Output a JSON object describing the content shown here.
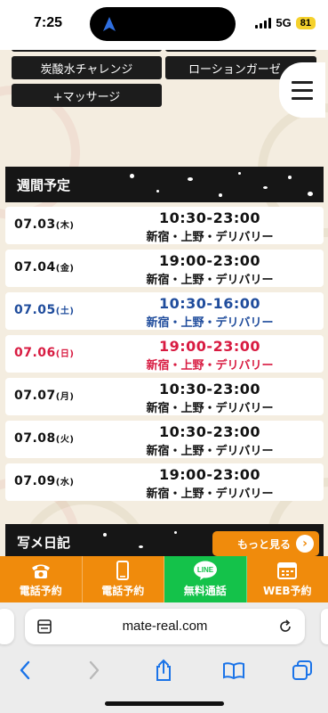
{
  "status": {
    "time": "7:25",
    "network": "5G",
    "battery": "81"
  },
  "tags": [
    "炭酸水チャレンジ",
    "ローションガーゼ",
    "+マッサージ"
  ],
  "weekly": {
    "title": "週間予定",
    "rows": [
      {
        "date": "07.03",
        "day": "(木)",
        "time": "10:30-23:00",
        "area": "新宿・上野・デリバリー",
        "color": "#111111"
      },
      {
        "date": "07.04",
        "day": "(金)",
        "time": "19:00-23:00",
        "area": "新宿・上野・デリバリー",
        "color": "#111111"
      },
      {
        "date": "07.05",
        "day": "(土)",
        "time": "10:30-16:00",
        "area": "新宿・上野・デリバリー",
        "color": "#1f4c9c"
      },
      {
        "date": "07.06",
        "day": "(日)",
        "time": "19:00-23:00",
        "area": "新宿・上野・デリバリー",
        "color": "#d81b41"
      },
      {
        "date": "07.07",
        "day": "(月)",
        "time": "10:30-23:00",
        "area": "新宿・上野・デリバリー",
        "color": "#111111"
      },
      {
        "date": "07.08",
        "day": "(火)",
        "time": "10:30-23:00",
        "area": "新宿・上野・デリバリー",
        "color": "#111111"
      },
      {
        "date": "07.09",
        "day": "(水)",
        "time": "19:00-23:00",
        "area": "新宿・上野・デリバリー",
        "color": "#111111"
      }
    ]
  },
  "diary": {
    "title": "写メ日記",
    "more": "もっと見る"
  },
  "cta": [
    {
      "label": "電話予約",
      "icon": "phone-icon"
    },
    {
      "label": "電話予約",
      "icon": "smartphone-icon"
    },
    {
      "label": "無料通話",
      "icon": "line-icon",
      "badge": "LINE"
    },
    {
      "label": "WEB予約",
      "icon": "calendar-icon"
    }
  ],
  "browser": {
    "url": "mate-real.com"
  },
  "colors": {
    "accent_orange": "#f08b0c",
    "line_green": "#14c24a",
    "header_black": "#161616"
  }
}
